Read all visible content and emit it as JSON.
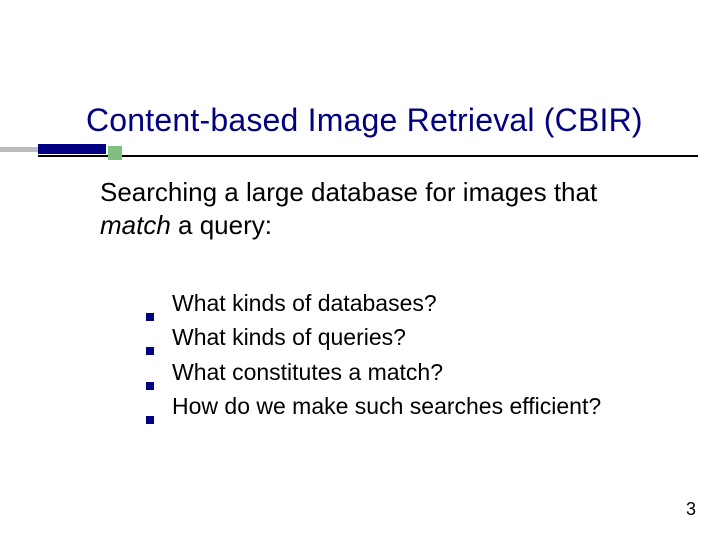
{
  "title": "Content-based Image Retrieval (CBIR)",
  "intro": {
    "pre": "Searching a large database for images that ",
    "italic": "match",
    "post": " a query:"
  },
  "bullets": [
    "What kinds of databases?",
    "What kinds of queries?",
    "What constitutes a match?",
    "How do we make such searches efficient?"
  ],
  "page_number": "3"
}
